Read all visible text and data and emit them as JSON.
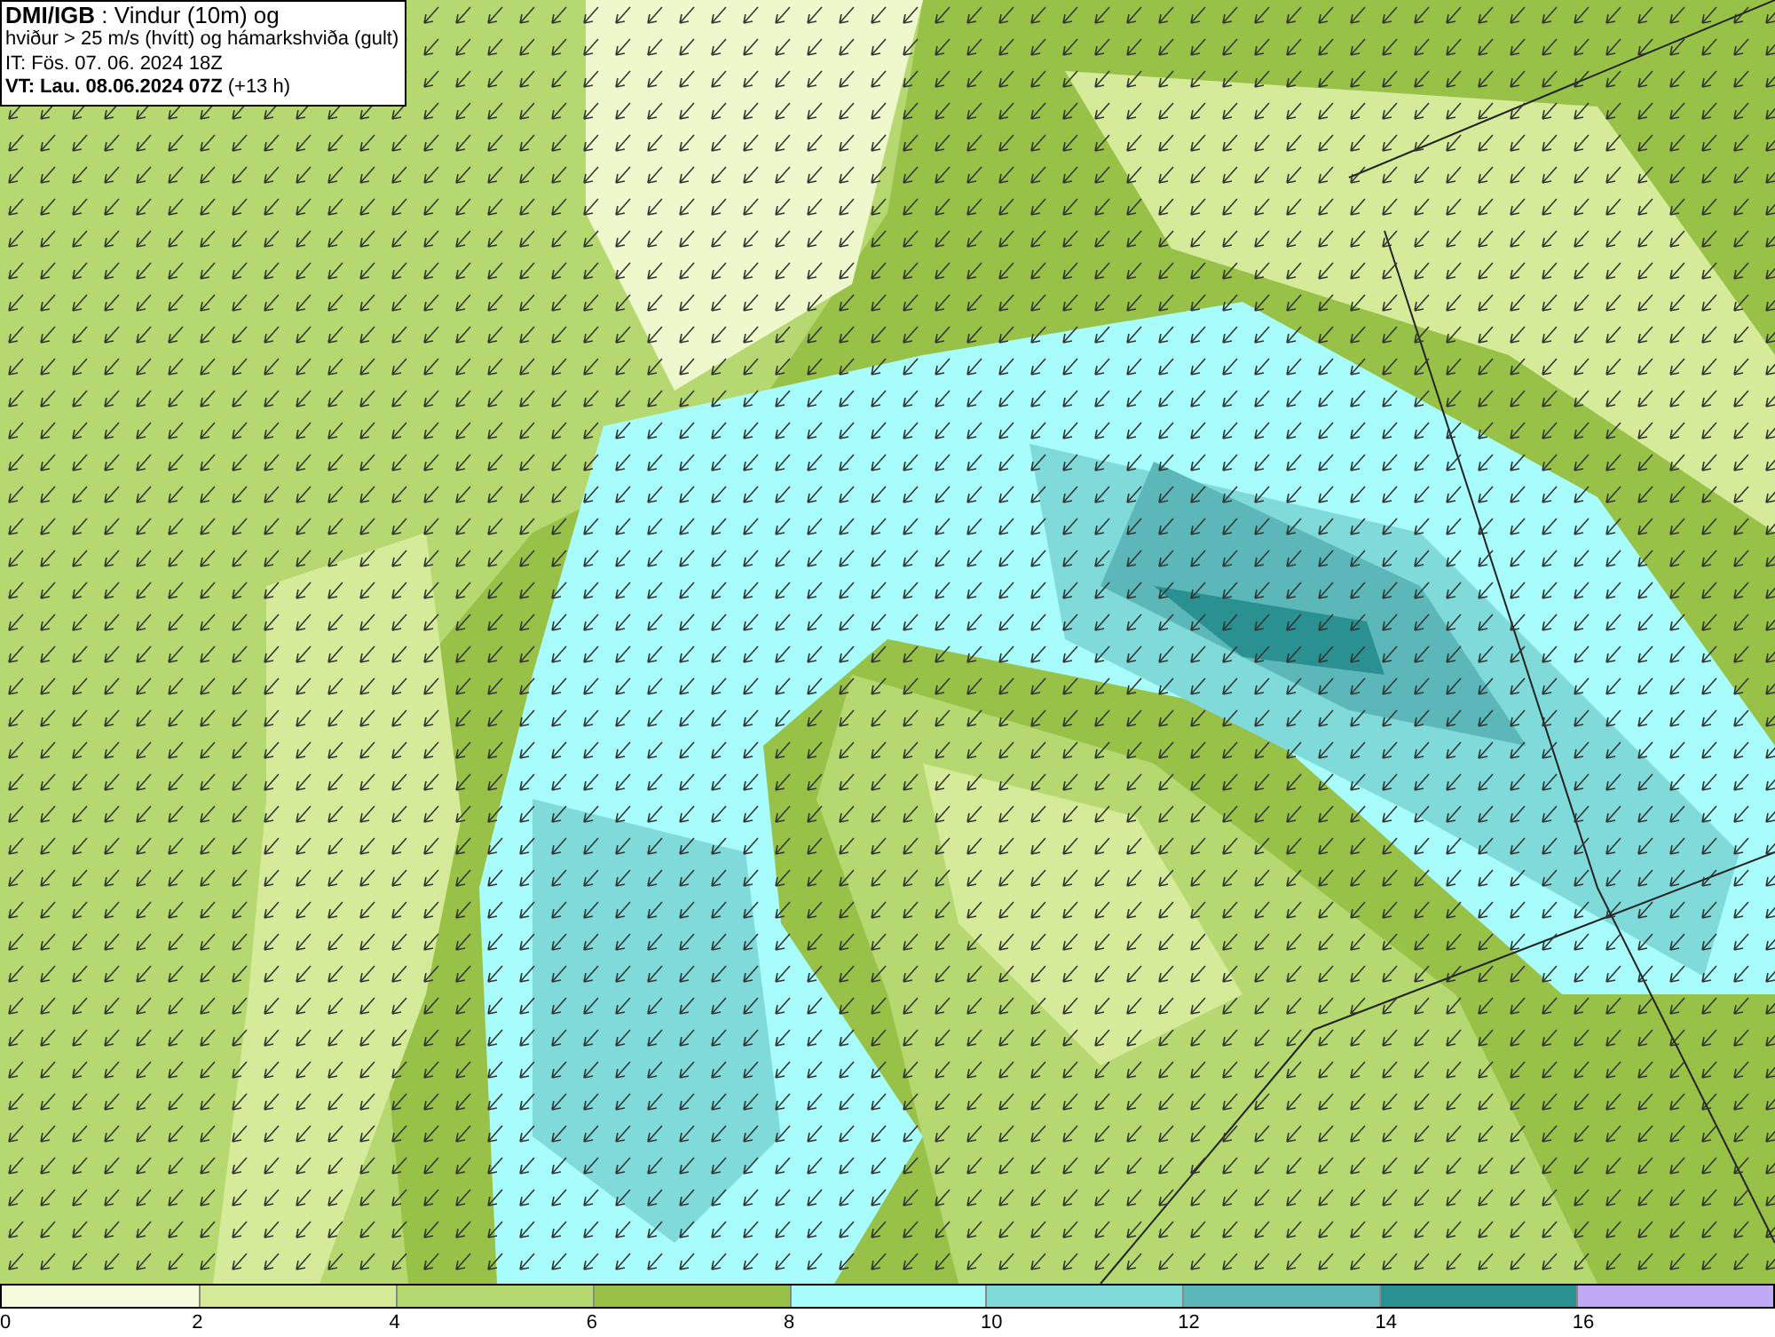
{
  "title_box": {
    "lines": [
      "**DMI/IGB** : Vindur (10m) og",
      "hviður > 25 m/s (hvítt) og hámarkshviða (gult)",
      "IT: Fös. 07. 06. 2024 18Z",
      "**VT: Lau. 08.06.2024 07Z** (+13 h)"
    ]
  },
  "legend": {
    "segments": [
      {
        "color": "#f5fbdc"
      },
      {
        "color": "#d5eb9a"
      },
      {
        "color": "#b6d870"
      },
      {
        "color": "#98c148"
      },
      {
        "color": "#a8fcfb"
      },
      {
        "color": "#80dada"
      },
      {
        "color": "#5cb8b8"
      },
      {
        "color": "#2a9090"
      },
      {
        "color": "#c0aaf5"
      }
    ],
    "ticks": [
      "0",
      "2",
      "4",
      "6",
      "8",
      "10",
      "12",
      "14",
      "16"
    ]
  }
}
